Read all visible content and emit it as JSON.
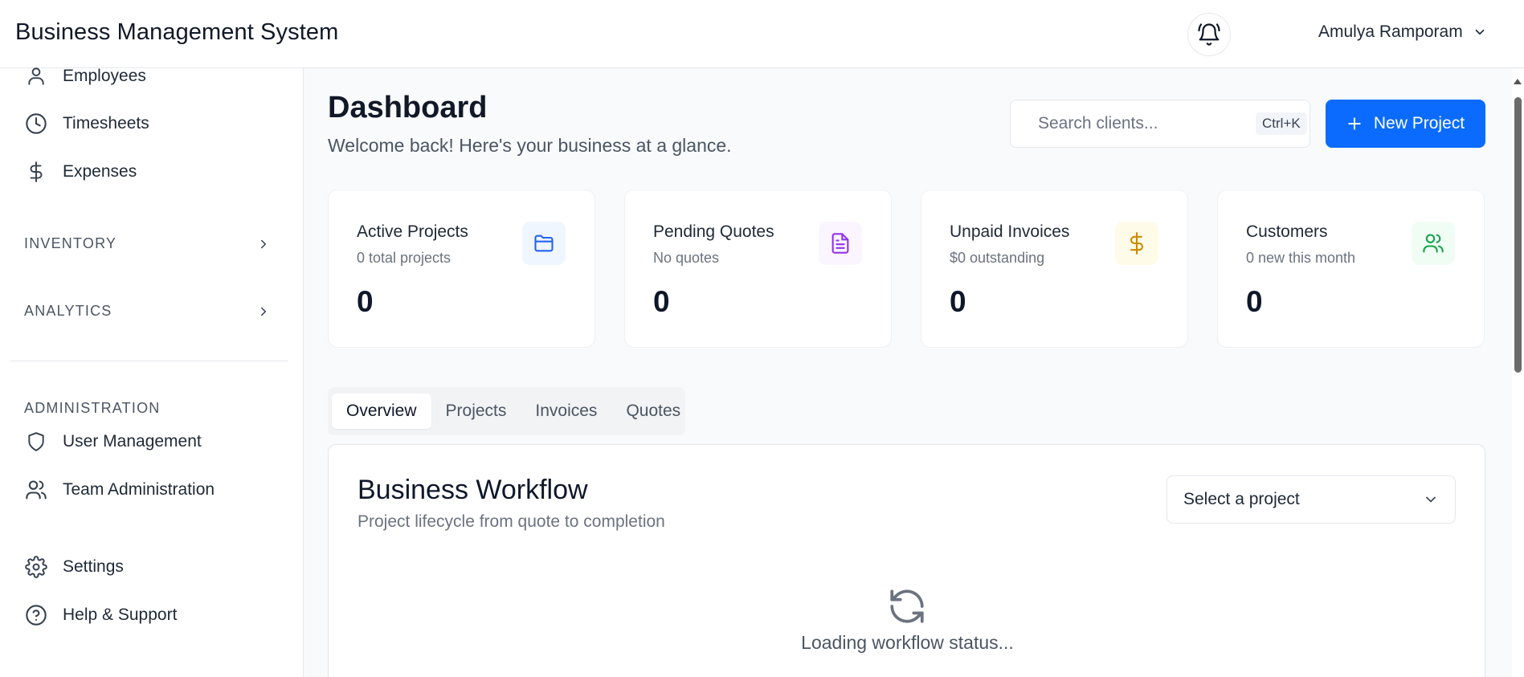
{
  "header": {
    "app_title": "Business Management System",
    "user_name": "Amulya Ramporam"
  },
  "sidebar": {
    "items_top": [
      {
        "label": "Employees",
        "icon": "user-icon"
      },
      {
        "label": "Timesheets",
        "icon": "clock-icon"
      },
      {
        "label": "Expenses",
        "icon": "dollar-icon"
      }
    ],
    "sections": [
      {
        "label": "INVENTORY"
      },
      {
        "label": "ANALYTICS"
      }
    ],
    "admin_heading": "ADMINISTRATION",
    "admin_items": [
      {
        "label": "User Management",
        "icon": "shield-icon"
      },
      {
        "label": "Team Administration",
        "icon": "users-icon"
      }
    ],
    "bottom_items": [
      {
        "label": "Settings",
        "icon": "gear-icon"
      },
      {
        "label": "Help & Support",
        "icon": "help-circle-icon"
      }
    ]
  },
  "main": {
    "title": "Dashboard",
    "subtitle": "Welcome back! Here's your business at a glance.",
    "search": {
      "placeholder": "Search clients...",
      "shortcut": "Ctrl+K"
    },
    "new_project_label": "New Project",
    "stats": [
      {
        "label": "Active Projects",
        "sub": "0 total projects",
        "value": "0",
        "icon": "folder-icon",
        "color": "#2563eb",
        "bg": "#eff6ff"
      },
      {
        "label": "Pending Quotes",
        "sub": "No quotes",
        "value": "0",
        "icon": "file-text-icon",
        "color": "#9333ea",
        "bg": "#faf5ff"
      },
      {
        "label": "Unpaid Invoices",
        "sub": "$0 outstanding",
        "value": "0",
        "icon": "dollar-icon",
        "color": "#ca8a04",
        "bg": "#fefce8"
      },
      {
        "label": "Customers",
        "sub": "0 new this month",
        "value": "0",
        "icon": "users-icon",
        "color": "#16a34a",
        "bg": "#f0fdf4"
      }
    ],
    "tabs": [
      "Overview",
      "Projects",
      "Invoices",
      "Quotes"
    ],
    "active_tab": "Overview",
    "workflow": {
      "title": "Business Workflow",
      "subtitle": "Project lifecycle from quote to completion",
      "select_value": "Select a project",
      "loading_text": "Loading workflow status..."
    }
  },
  "colors": {
    "accent": "#0b6bff"
  }
}
